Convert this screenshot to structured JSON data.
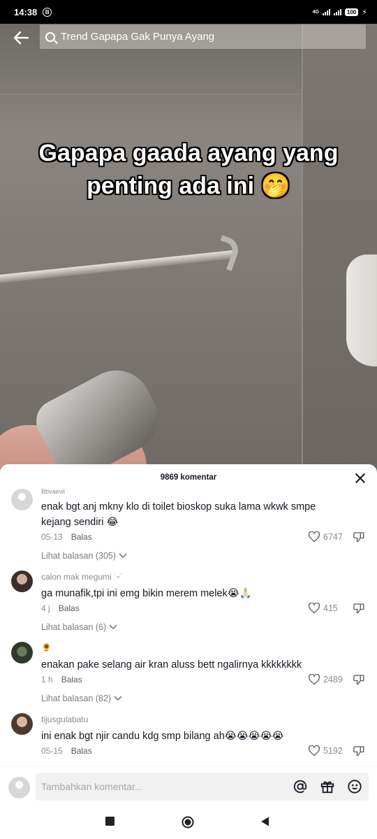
{
  "status_bar": {
    "time": "14:38",
    "badge": "B",
    "network": "4G",
    "battery": "100"
  },
  "video": {
    "search_text": "Trend Gapapa Gak Punya Ayang",
    "caption": "Gapapa gaada ayang yang penting ada ini 🤭"
  },
  "comments_panel": {
    "count_label": "9869 komentar",
    "comments": [
      {
        "username": "Bbyaevii",
        "text": "enak bgt anj mkny klo di toilet bioskop suka lama wkwk smpe kejang sendiri 😂",
        "date": "05-13",
        "reply_label": "Balas",
        "likes": "6747",
        "view_replies": "Lihat balasan (305)"
      },
      {
        "username": "calon mak megumi",
        "username_emoji": "˙ᵕ˙",
        "text": "ga munafik,tpi ini emg bikin merem melek😭🙏🏻",
        "date": "4 j",
        "reply_label": "Balas",
        "likes": "415",
        "view_replies": "Lihat balasan (6)"
      },
      {
        "username": "🌻",
        "text": "enakan pake selang air kran aluss bett ngalirnya kkkkkkkk",
        "date": "1 h",
        "reply_label": "Balas",
        "likes": "2489",
        "view_replies": "Lihat balasan (82)"
      },
      {
        "username": "tijusgulabatu",
        "text": "ini enak bgt njir candu kdg smp bilang ah😭😭😭😭😭",
        "date": "05-15",
        "reply_label": "Balas",
        "likes": "5192"
      }
    ]
  },
  "input_bar": {
    "placeholder": "Tambahkan komentar..."
  },
  "icons": {
    "back": "arrow-left-icon",
    "search": "search-icon",
    "close": "close-icon",
    "like": "heart-icon",
    "dislike": "dislike-icon",
    "mention": "at-sign-icon",
    "gift": "gift-icon",
    "emoji": "smiley-icon"
  }
}
